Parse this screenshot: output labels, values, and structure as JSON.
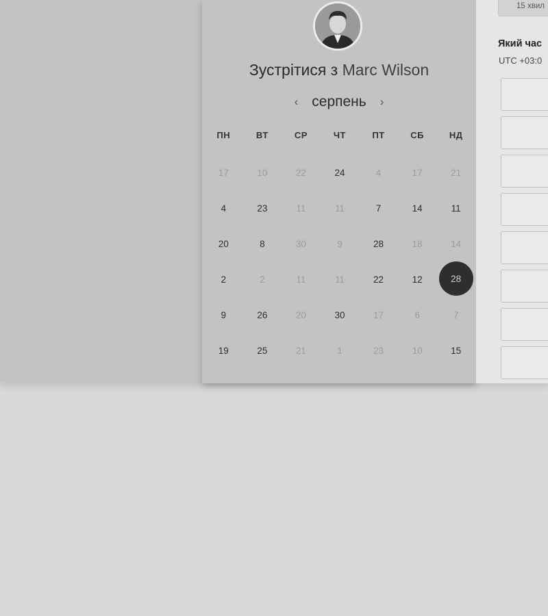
{
  "header": {
    "title_prefix": "Зустрітися з",
    "host_name": "Marc Wilson"
  },
  "calendar": {
    "month": "серпень",
    "prev_icon": "chevron-left-icon",
    "next_icon": "chevron-right-icon",
    "weekdays": [
      "ПН",
      "ВТ",
      "СР",
      "ЧТ",
      "ПТ",
      "СБ",
      "НД"
    ],
    "days": [
      {
        "label": "17",
        "state": "muted"
      },
      {
        "label": "10",
        "state": "muted"
      },
      {
        "label": "22",
        "state": "muted"
      },
      {
        "label": "24",
        "state": "active"
      },
      {
        "label": "4",
        "state": "muted"
      },
      {
        "label": "17",
        "state": "muted"
      },
      {
        "label": "21",
        "state": "muted"
      },
      {
        "label": "4",
        "state": "active"
      },
      {
        "label": "23",
        "state": "active"
      },
      {
        "label": "11",
        "state": "muted"
      },
      {
        "label": "11",
        "state": "muted"
      },
      {
        "label": "7",
        "state": "active"
      },
      {
        "label": "14",
        "state": "active"
      },
      {
        "label": "11",
        "state": "active"
      },
      {
        "label": "20",
        "state": "active"
      },
      {
        "label": "8",
        "state": "active"
      },
      {
        "label": "30",
        "state": "muted"
      },
      {
        "label": "9",
        "state": "muted"
      },
      {
        "label": "28",
        "state": "active"
      },
      {
        "label": "18",
        "state": "muted"
      },
      {
        "label": "14",
        "state": "muted"
      },
      {
        "label": "2",
        "state": "active"
      },
      {
        "label": "2",
        "state": "muted"
      },
      {
        "label": "11",
        "state": "muted"
      },
      {
        "label": "11",
        "state": "muted"
      },
      {
        "label": "22",
        "state": "active"
      },
      {
        "label": "12",
        "state": "active"
      },
      {
        "label": "28",
        "state": "selected"
      },
      {
        "label": "9",
        "state": "active"
      },
      {
        "label": "26",
        "state": "active"
      },
      {
        "label": "20",
        "state": "muted"
      },
      {
        "label": "30",
        "state": "active"
      },
      {
        "label": "17",
        "state": "muted"
      },
      {
        "label": "6",
        "state": "muted"
      },
      {
        "label": "7",
        "state": "muted"
      },
      {
        "label": "19",
        "state": "active"
      },
      {
        "label": "25",
        "state": "active"
      },
      {
        "label": "21",
        "state": "muted"
      },
      {
        "label": "1",
        "state": "muted"
      },
      {
        "label": "23",
        "state": "muted"
      },
      {
        "label": "10",
        "state": "muted"
      },
      {
        "label": "15",
        "state": "active"
      }
    ]
  },
  "right_panel": {
    "duration_label": "15 хвил",
    "question": "Який час",
    "timezone": "UTC +03:0"
  },
  "time_slots": [
    "",
    "",
    "",
    "",
    "",
    "",
    "",
    ""
  ],
  "colors": {
    "selected_day_bg": "#2e2e2e",
    "card_bg": "#c3c3c3",
    "page_bg": "#d8d8d8"
  }
}
